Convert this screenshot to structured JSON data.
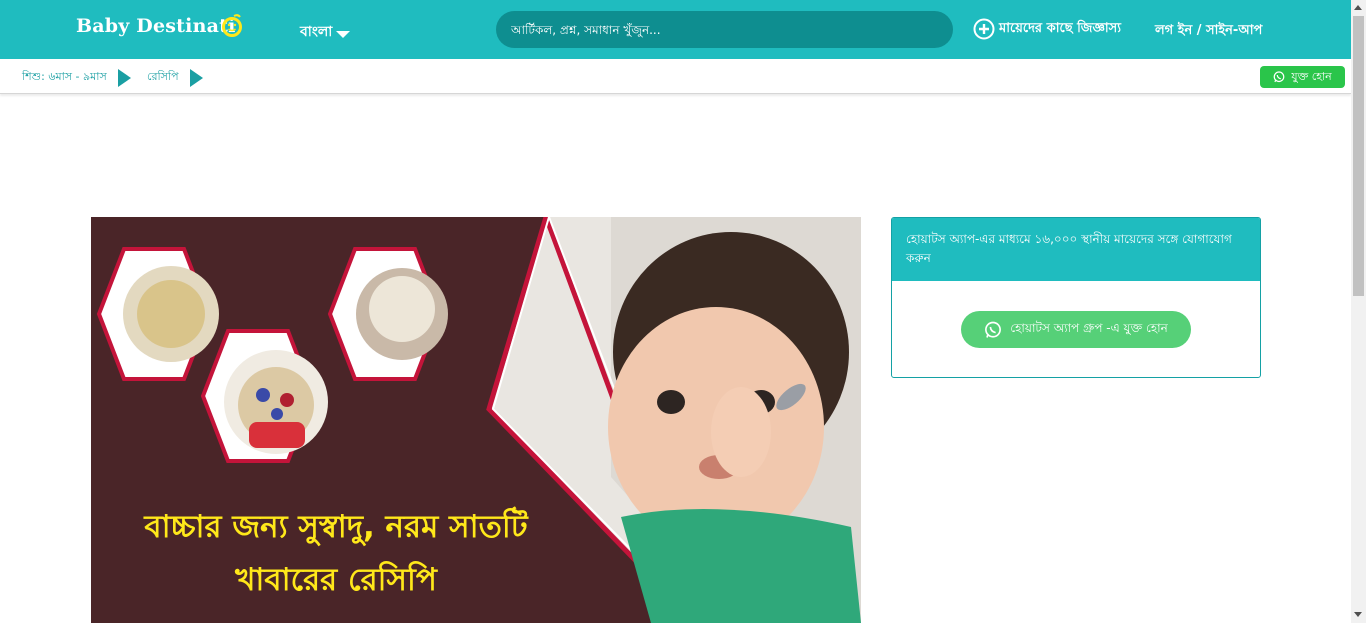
{
  "header": {
    "logo_text": "Baby Destinati",
    "logo_o": "o",
    "language": "বাংলা",
    "search_placeholder": "আর্টিকল, প্রশ্ন, সমাধান খুঁজুন...",
    "ask_label": "মায়েদের কাছে জিজ্ঞাস্য",
    "login_label": "লগ ইন / সাইন-আপ"
  },
  "breadcrumb": [
    {
      "label": "শিশু: ৬মাস - ৯মাস"
    },
    {
      "label": "রেসিপি"
    }
  ],
  "subbar_join_label": "যুক্ত হোন",
  "hero": {
    "title_line1": "বাচ্চার জন্য সুস্বাদু, নরম সাতটি",
    "title_line2": "খাবারের রেসিপি"
  },
  "sidebar_card": {
    "heading": "হোয়াটস অ্যাপ-এর মাধ্যমে ১৬,০০০ স্থানীয় মায়েদের সঙ্গে যোগাযোগ করুন",
    "button_label": "হোয়াটস অ্যাপ গ্রুপ -এ যুক্ত হোন"
  },
  "icons": {
    "whatsapp": "whatsapp-icon",
    "plus": "plus-circle-icon",
    "caret": "caret-down-icon",
    "breadcrumb_arrow": "play-arrow-icon"
  },
  "colors": {
    "brand": "#1fbcbf",
    "search_bg": "#0e8e90",
    "whatsapp_green": "#2ac54a",
    "hero_bg": "#4a2528",
    "hero_title": "#ffe81a"
  }
}
